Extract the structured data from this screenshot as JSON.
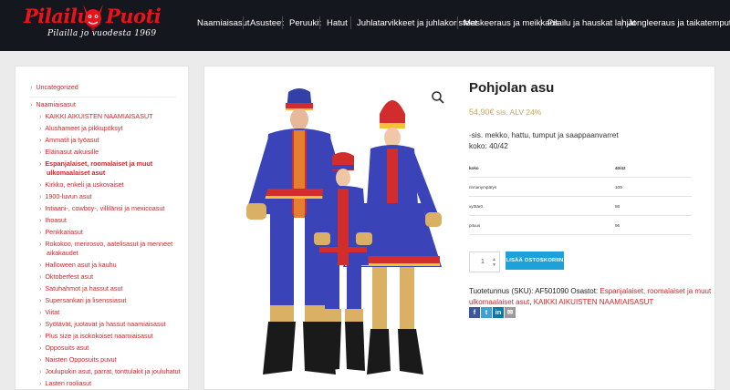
{
  "header": {
    "logo_word1": "Pilailu",
    "logo_word2": "Puoti",
    "logo_tagline": "Pilailla jo vuodesta 1969",
    "nav": [
      "Naamiaisasut",
      "Asusteet",
      "Peruukit",
      "Hatut",
      "Juhlatarvikkeet ja juhlakoristeet",
      "Maskeeraus ja meikkaus",
      "Pilailu ja hauskat lahjat",
      "Jongleeraus ja taikatemput"
    ]
  },
  "sidebar": {
    "categories": [
      "Uncategorized",
      "Naamiaisasut",
      "KAIKKI AIKUISTEN NAAMIAISASUT",
      "Alushameet ja pikkupöksyt",
      "Ammatit ja työasut",
      "Eläinasut aikuisille",
      "Espanjalaiset, roomalaiset ja muut",
      "ulkomaalaiset asut",
      "Kirkko, enkeli ja uskovaiset",
      "1900-luvun asut",
      "Intiaani-, cowboy-, villilänsi ja mexicoasut",
      "Ihoasut",
      "Penkkariasut",
      "Rokokoo, merirosvo, aatelisasut ja menneet",
      "aikakaudet",
      "Halloween asut ja kauhu",
      "Oktoberfest asut",
      "Satuhahmot ja hassut asut",
      "Supersankari ja lisenssiasut",
      "Viitat",
      "Syötävät, juotavat ja hassut naamiaisasut",
      "Plus size ja isokokoiset naamiaisasut",
      "Opposuits asut",
      "Naisten Opposuits puvut",
      "Joulupukin asut, parrat, tonttulakit ja jouluhatut",
      "Lasten rooliasut"
    ]
  },
  "product": {
    "title": "Pohjolan asu",
    "price": "54,90€",
    "price_suffix": "sis. ALV 24%",
    "desc_line1": "-sis. mekko, hattu, tumput ja saappaanvarret",
    "desc_line2": "koko: 40/42",
    "table": {
      "header": [
        "koko",
        "40/42"
      ],
      "rows": [
        [
          "rinnanympärys",
          "100"
        ],
        [
          "vyötärö",
          "86"
        ],
        [
          "pituus",
          "96"
        ]
      ]
    },
    "quantity": "1",
    "add_to_cart": "LISÄÄ OSTOSKORIIN",
    "sku_label": "Tuotetunnus (SKU):",
    "sku": "AF501090",
    "categories_label": "Osastot:",
    "category_link1_a": "Espanjalaiset, roomalaiset ja muut",
    "category_link1_b": "ulkomaalaiset asut",
    "category_link2": "KAIKKI AIKUISTEN NAAMIAISASUT",
    "social": [
      "f",
      "t",
      "in",
      "✉"
    ]
  },
  "colors": {
    "header_bg": "#15171e",
    "accent_red": "#d9222a",
    "price_gold": "#c4a95a",
    "button_blue": "#1ea1d8"
  }
}
